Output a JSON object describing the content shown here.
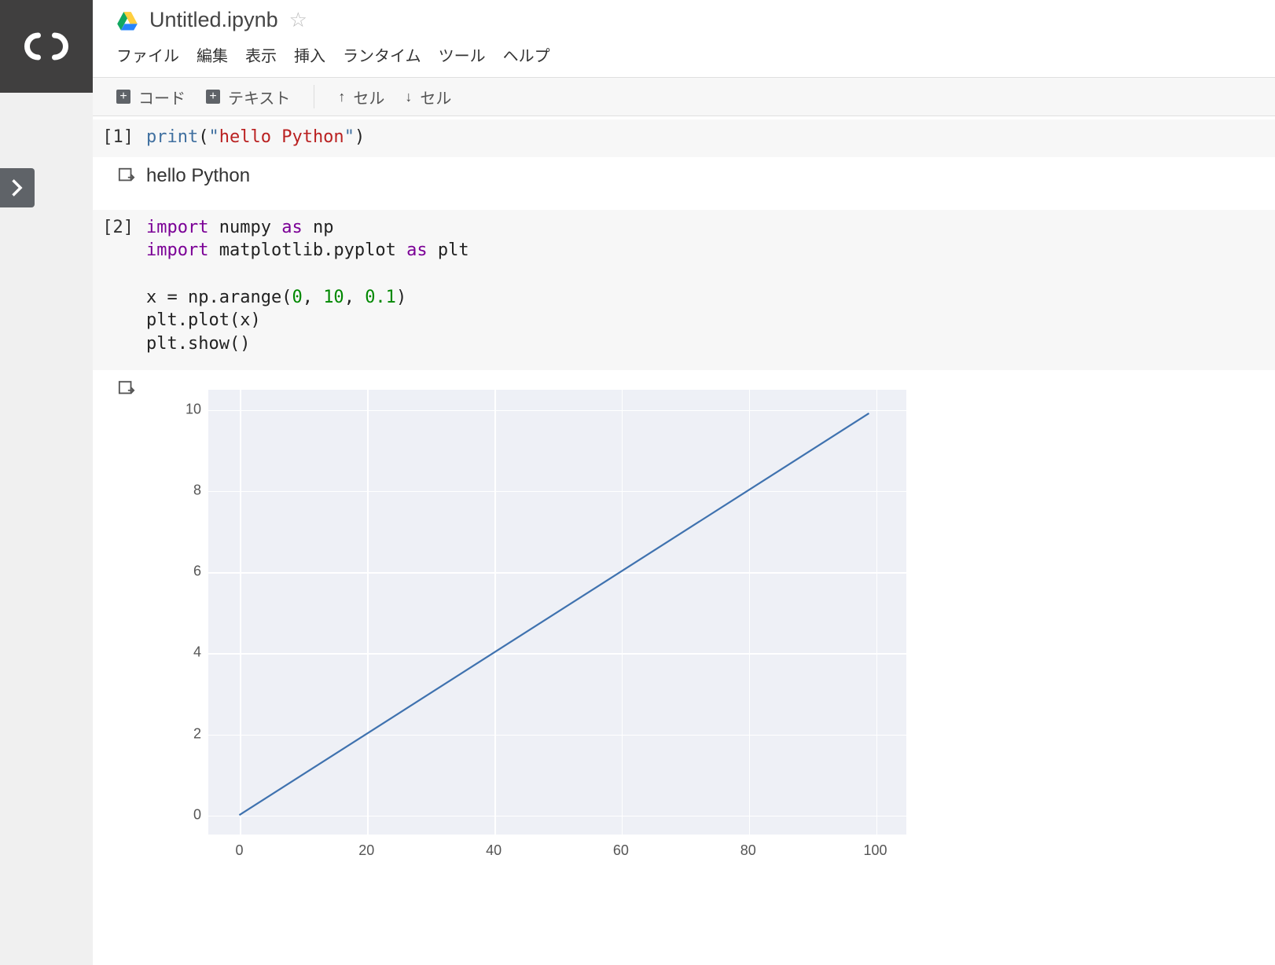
{
  "header": {
    "title": "Untitled.ipynb"
  },
  "menu": {
    "file": "ファイル",
    "edit": "編集",
    "view": "表示",
    "insert": "挿入",
    "runtime": "ランタイム",
    "tools": "ツール",
    "help": "ヘルプ"
  },
  "toolbar": {
    "code": "コード",
    "text": "テキスト",
    "cell_up": "セル",
    "cell_down": "セル"
  },
  "cells": [
    {
      "prompt": "[1]",
      "output_text": "hello Python"
    },
    {
      "prompt": "[2]"
    }
  ],
  "code1": {
    "fn": "print",
    "open": "(",
    "q1": "\"",
    "str": "hello Python",
    "q2": "\"",
    "close": ")"
  },
  "code2": {
    "l1_import": "import",
    "l1_mod": " numpy ",
    "l1_as": "as",
    "l1_alias": " np",
    "l2_import": "import",
    "l2_mod": " matplotlib.pyplot ",
    "l2_as": "as",
    "l2_alias": " plt",
    "l4_a": "x = np.arange(",
    "l4_n1": "0",
    "l4_c1": ", ",
    "l4_n2": "10",
    "l4_c2": ", ",
    "l4_n3": "0.1",
    "l4_b": ")",
    "l5": "plt.plot(x)",
    "l6": "plt.show()"
  },
  "chart_data": {
    "type": "line",
    "x": [
      0,
      99
    ],
    "y": [
      0,
      9.9
    ],
    "xlim": [
      -5,
      105
    ],
    "ylim": [
      -0.5,
      10.5
    ],
    "xticks": [
      0,
      20,
      40,
      60,
      80,
      100
    ],
    "yticks": [
      0,
      2,
      4,
      6,
      8,
      10
    ],
    "line_color": "#3f72af"
  }
}
